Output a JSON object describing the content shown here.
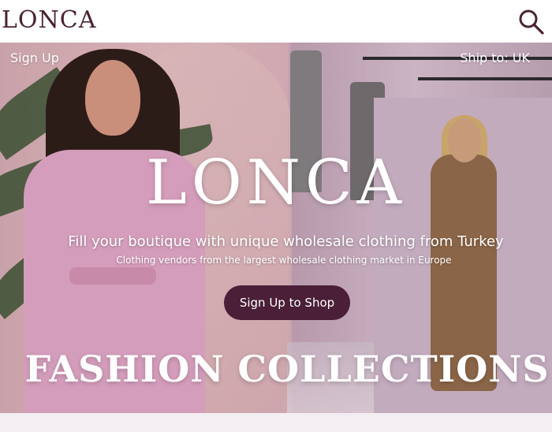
{
  "header": {
    "logo": "LONCA",
    "search_icon": "search-icon"
  },
  "hero": {
    "signup_link": "Sign Up",
    "ship_to": "Ship to: UK",
    "brand": "LONCA",
    "headline": "Fill your boutique with unique wholesale clothing from Turkey",
    "subheadline": "Clothing vendors from the largest wholesale clothing market in Europe",
    "cta_label": "Sign Up to Shop",
    "collections_title": "FASHION COLLECTIONS"
  },
  "colors": {
    "brand": "#4a2233",
    "cta_background": "#4a1f37",
    "hero_text": "#ffffff"
  }
}
